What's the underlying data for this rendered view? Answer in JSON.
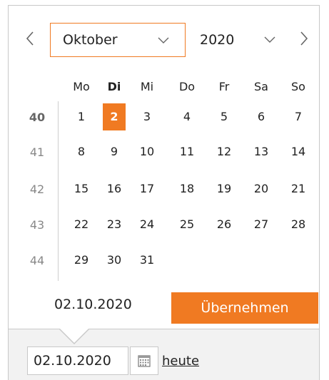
{
  "picker": {
    "month": "Oktober",
    "year": "2020",
    "weekdays": [
      "Mo",
      "Di",
      "Mi",
      "Do",
      "Fr",
      "Sa",
      "So"
    ],
    "weeks": [
      {
        "week": "40",
        "days": [
          "1",
          "2",
          "3",
          "4",
          "5",
          "6",
          "7"
        ]
      },
      {
        "week": "41",
        "days": [
          "8",
          "9",
          "10",
          "11",
          "12",
          "13",
          "14"
        ]
      },
      {
        "week": "42",
        "days": [
          "15",
          "16",
          "17",
          "18",
          "19",
          "20",
          "21"
        ]
      },
      {
        "week": "43",
        "days": [
          "22",
          "23",
          "24",
          "25",
          "26",
          "27",
          "28"
        ]
      },
      {
        "week": "44",
        "days": [
          "29",
          "30",
          "31"
        ]
      }
    ],
    "selected_date": "02.10.2020",
    "apply_label": "Übernehmen"
  },
  "field": {
    "value": "02.10.2020",
    "today_label": "heute"
  },
  "colors": {
    "accent": "#f07a22",
    "border": "#c8c8c8"
  }
}
